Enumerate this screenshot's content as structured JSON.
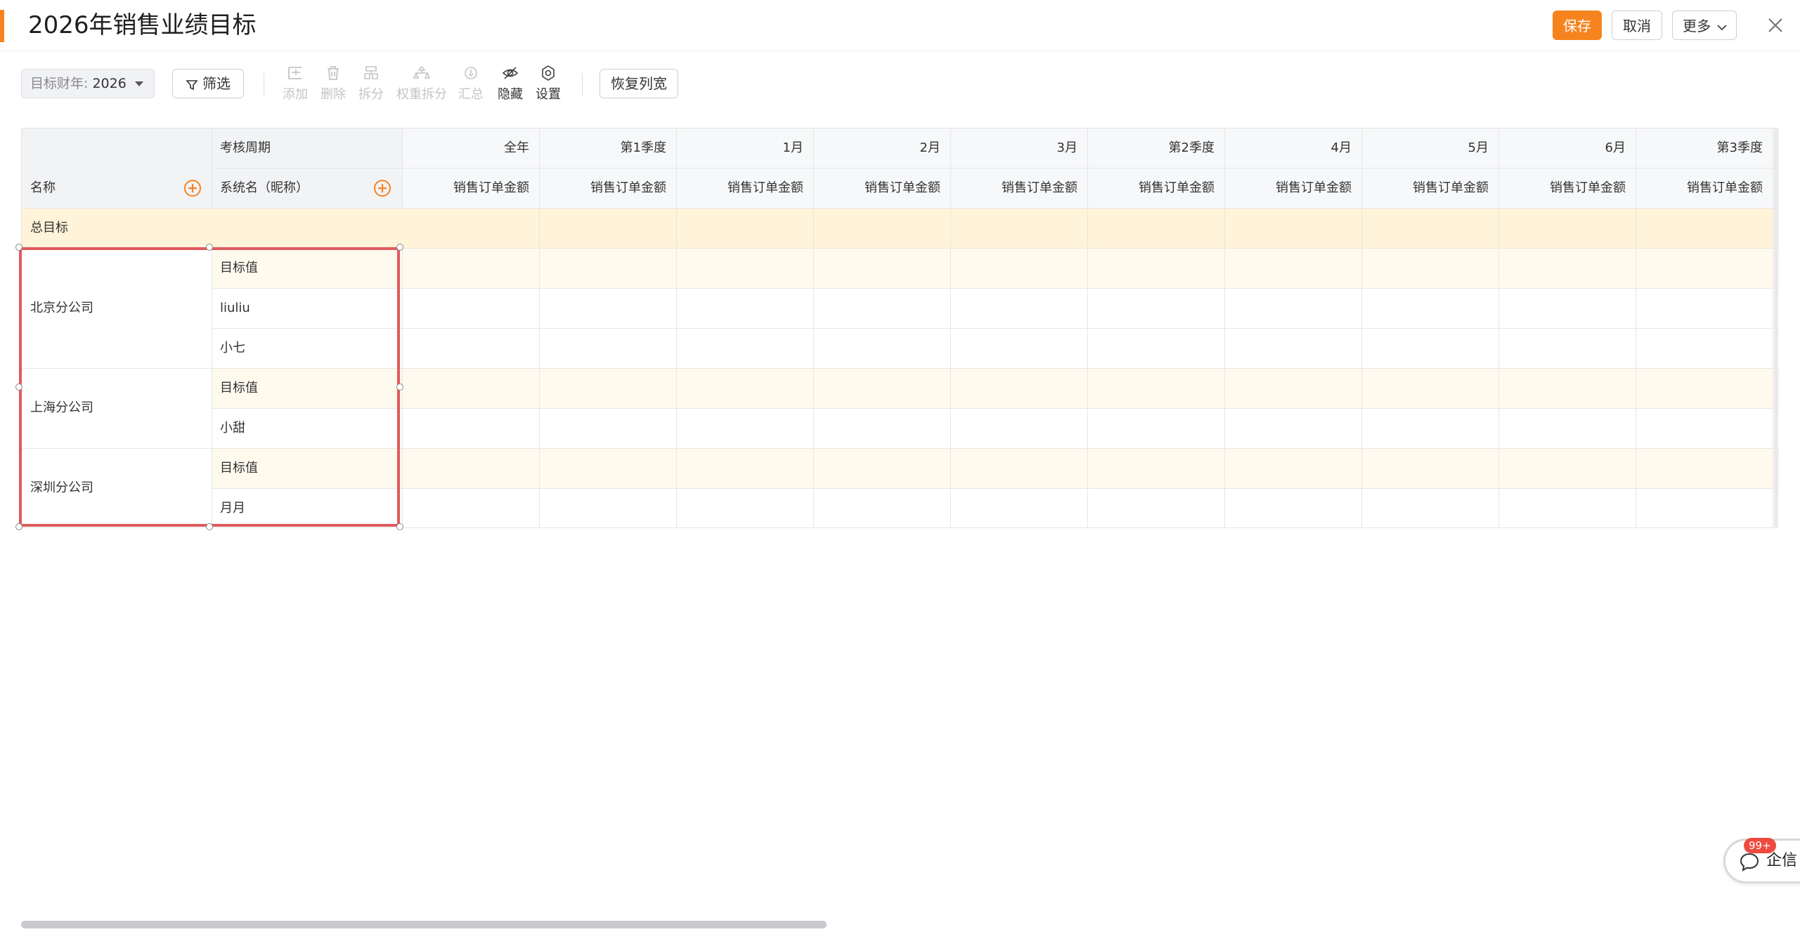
{
  "header": {
    "title": "2026年销售业绩目标",
    "save_label": "保存",
    "cancel_label": "取消",
    "more_label": "更多"
  },
  "toolbar": {
    "year_label": "目标财年:",
    "year_value": "2026",
    "filter_label": "筛选",
    "tools": [
      {
        "label": "添加",
        "icon": "add-row-icon",
        "enabled": false
      },
      {
        "label": "删除",
        "icon": "trash-icon",
        "enabled": false
      },
      {
        "label": "拆分",
        "icon": "split-icon",
        "enabled": false
      },
      {
        "label": "权重拆分",
        "icon": "weight-split-icon",
        "enabled": false
      },
      {
        "label": "汇总",
        "icon": "summary-icon",
        "enabled": false
      },
      {
        "label": "隐藏",
        "icon": "eye-off-icon",
        "enabled": true
      },
      {
        "label": "设置",
        "icon": "gear-icon",
        "enabled": true
      }
    ],
    "restore_label": "恢复列宽"
  },
  "table": {
    "period_header": "考核周期",
    "name_header": "名称",
    "sysname_header": "系统名（昵称）",
    "periods": [
      "全年",
      "第1季度",
      "1月",
      "2月",
      "3月",
      "第2季度",
      "4月",
      "5月",
      "6月",
      "第3季度"
    ],
    "metric": "销售订单金额",
    "total_label": "总目标",
    "groups": [
      {
        "name": "北京分公司",
        "rows": [
          "目标值",
          "liuliu",
          "小七"
        ]
      },
      {
        "name": "上海分公司",
        "rows": [
          "目标值",
          "小甜"
        ]
      },
      {
        "name": "深圳分公司",
        "rows": [
          "目标值",
          "月月"
        ]
      }
    ]
  },
  "chat": {
    "label": "企信",
    "badge": "99+"
  },
  "colors": {
    "accent": "#f5841f",
    "header_bg": "#f2f3f5",
    "total_row_bg": "#fff3d9",
    "target_row_bg": "#fffaee",
    "selection_border": "#e05a5e"
  }
}
